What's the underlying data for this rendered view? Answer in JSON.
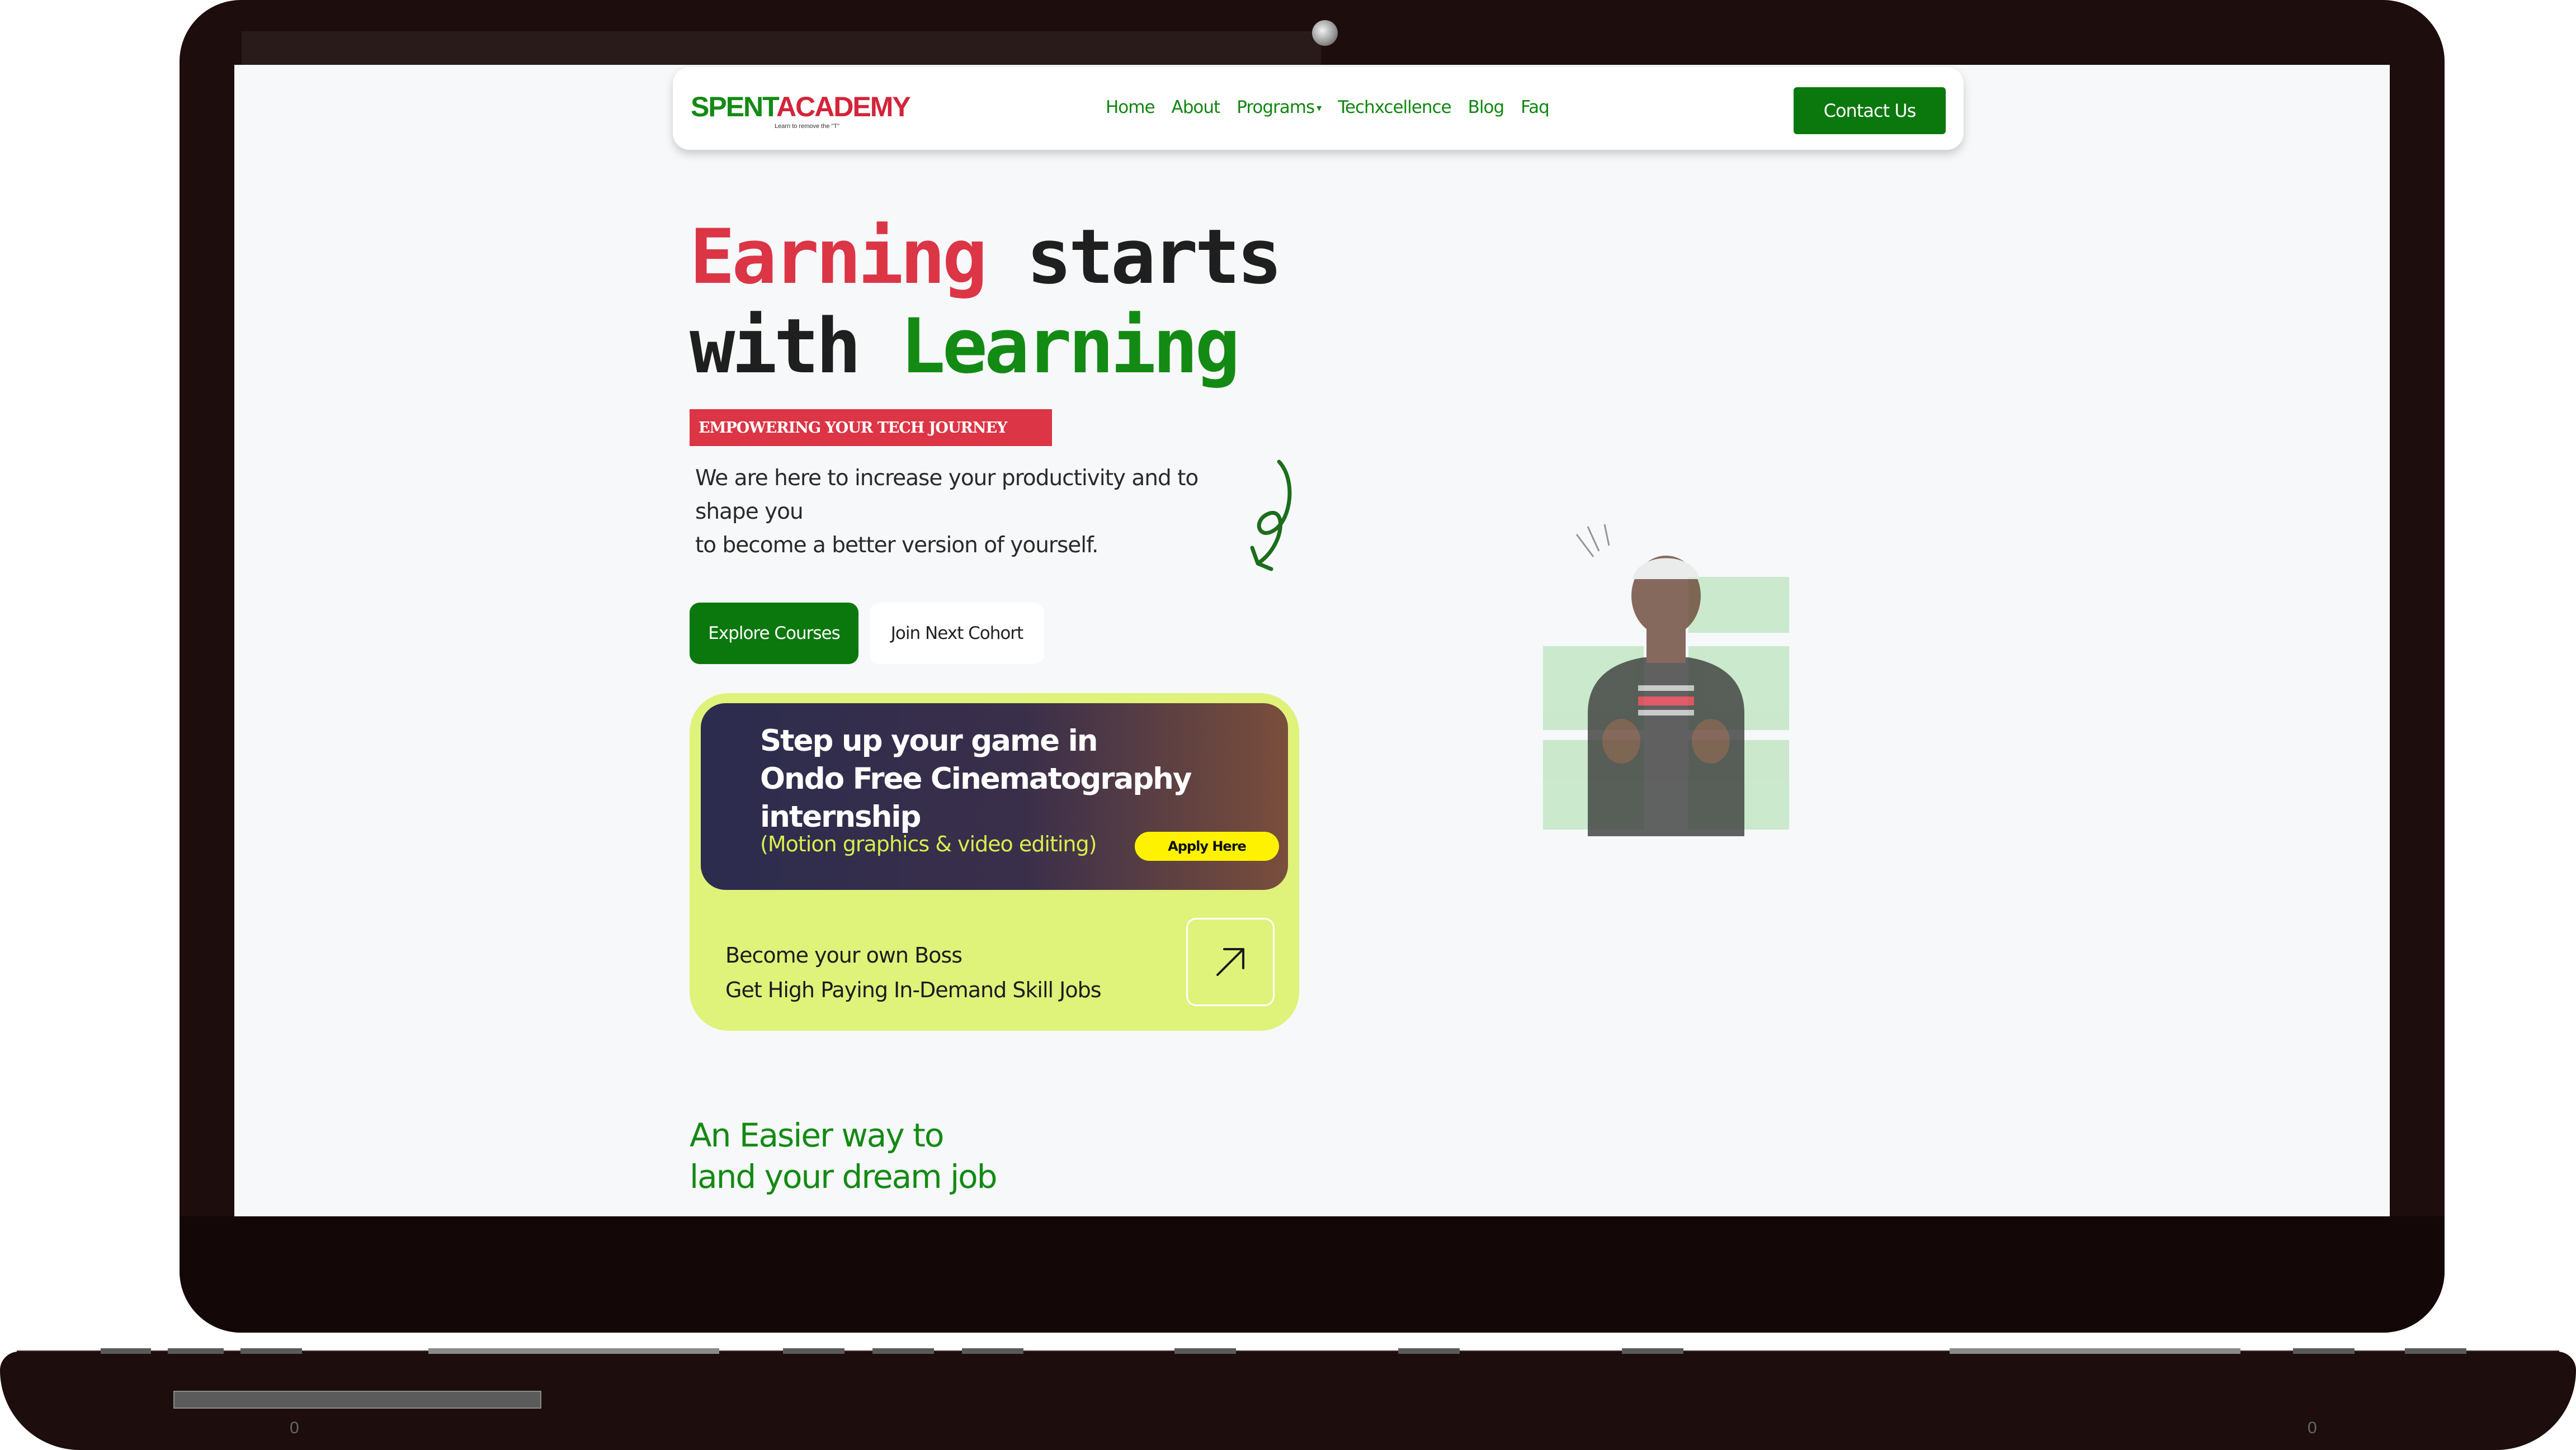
{
  "navbar": {
    "logo": {
      "text_a": "SPENT",
      "text_b": "ACADEMY",
      "tagline": "Learn to remove the \"T\""
    },
    "links": [
      {
        "label": "Home"
      },
      {
        "label": "About"
      },
      {
        "label": "Programs"
      },
      {
        "label": "Techxcellence"
      },
      {
        "label": "Blog"
      },
      {
        "label": "Faq"
      }
    ],
    "contact_label": "Contact Us"
  },
  "hero": {
    "title_word1": "Earning",
    "title_word2": " starts",
    "title_word3": "with ",
    "title_word4": "Learning",
    "badge": "EMPOWERING YOUR TECH JOURNEY",
    "description_lines": [
      "We are here to increase your productivity and to",
      "shape you",
      "to become a better version of yourself."
    ],
    "primary_button": "Explore Courses",
    "secondary_button": "Join Next Cohort"
  },
  "promo": {
    "title_lines": [
      "Step up your game in",
      "Ondo Free Cinematography",
      "internship"
    ],
    "subtitle": "(Motion graphics & video editing)",
    "apply_label": "Apply Here",
    "bottom_lines": [
      "Become your own Boss",
      "Get High Paying In-Demand Skill Jobs"
    ]
  },
  "lower_section": {
    "heading_lines": [
      "An Easier way to",
      "land your dream job"
    ]
  },
  "device": {
    "base_marks": [
      "0",
      "0"
    ]
  },
  "colors": {
    "brand_green": "#0a780d",
    "brand_red": "#dc3545",
    "promo_lime": "#dff27a",
    "apply_yellow": "#fff200"
  }
}
